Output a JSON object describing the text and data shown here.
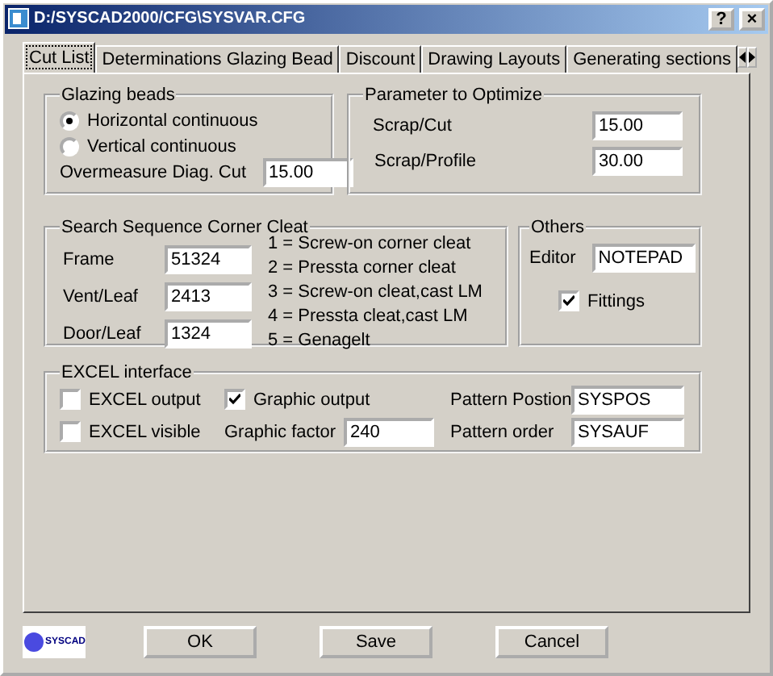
{
  "window": {
    "title": "D:/SYSCAD2000/CFG\\SYSVAR.CFG",
    "help_button": "?",
    "close_button": "×"
  },
  "tabs": [
    {
      "label": "Cut List",
      "selected": true
    },
    {
      "label": "Determinations Glazing Bead",
      "selected": false
    },
    {
      "label": "Discount",
      "selected": false
    },
    {
      "label": "Drawing Layouts",
      "selected": false
    },
    {
      "label": "Generating sections",
      "selected": false
    }
  ],
  "glazing_beads": {
    "title": "Glazing beads",
    "options": [
      {
        "label": "Horizontal continuous",
        "selected": true
      },
      {
        "label": "Vertical continuous",
        "selected": false
      }
    ],
    "overmeasure": {
      "label": "Overmeasure Diag. Cut",
      "value": "15.00"
    }
  },
  "parameter_to_optimize": {
    "title": "Parameter to Optimize",
    "fields": [
      {
        "label": "Scrap/Cut",
        "value": "15.00"
      },
      {
        "label": "Scrap/Profile",
        "value": "30.00"
      }
    ]
  },
  "search_sequence": {
    "title": "Search Sequence Corner Cleat",
    "fields": [
      {
        "label": "Frame",
        "value": "51324"
      },
      {
        "label": "Vent/Leaf",
        "value": "2413"
      },
      {
        "label": "Door/Leaf",
        "value": "1324"
      }
    ],
    "legend": [
      "1 = Screw-on corner cleat",
      "2 = Pressta corner cleat",
      "3 = Screw-on cleat,cast LM",
      "4 = Pressta cleat,cast LM",
      "5 = Genagelt"
    ]
  },
  "others": {
    "title": "Others",
    "editor": {
      "label": "Editor",
      "value": "NOTEPAD"
    },
    "fittings": {
      "label": "Fittings",
      "checked": true
    }
  },
  "excel_interface": {
    "title": "EXCEL interface",
    "checkboxes": [
      {
        "label": "EXCEL output",
        "checked": false
      },
      {
        "label": "EXCEL visible",
        "checked": false
      },
      {
        "label": "Graphic output",
        "checked": true
      }
    ],
    "graphic_factor": {
      "label": "Graphic factor",
      "value": "240"
    },
    "pattern_fields": [
      {
        "label": "Pattern Postion",
        "value": "SYSPOS"
      },
      {
        "label": "Pattern order",
        "value": "SYSAUF"
      }
    ]
  },
  "logo": {
    "text": "SYSCAD"
  },
  "buttons": [
    "OK",
    "Save",
    "Cancel"
  ]
}
